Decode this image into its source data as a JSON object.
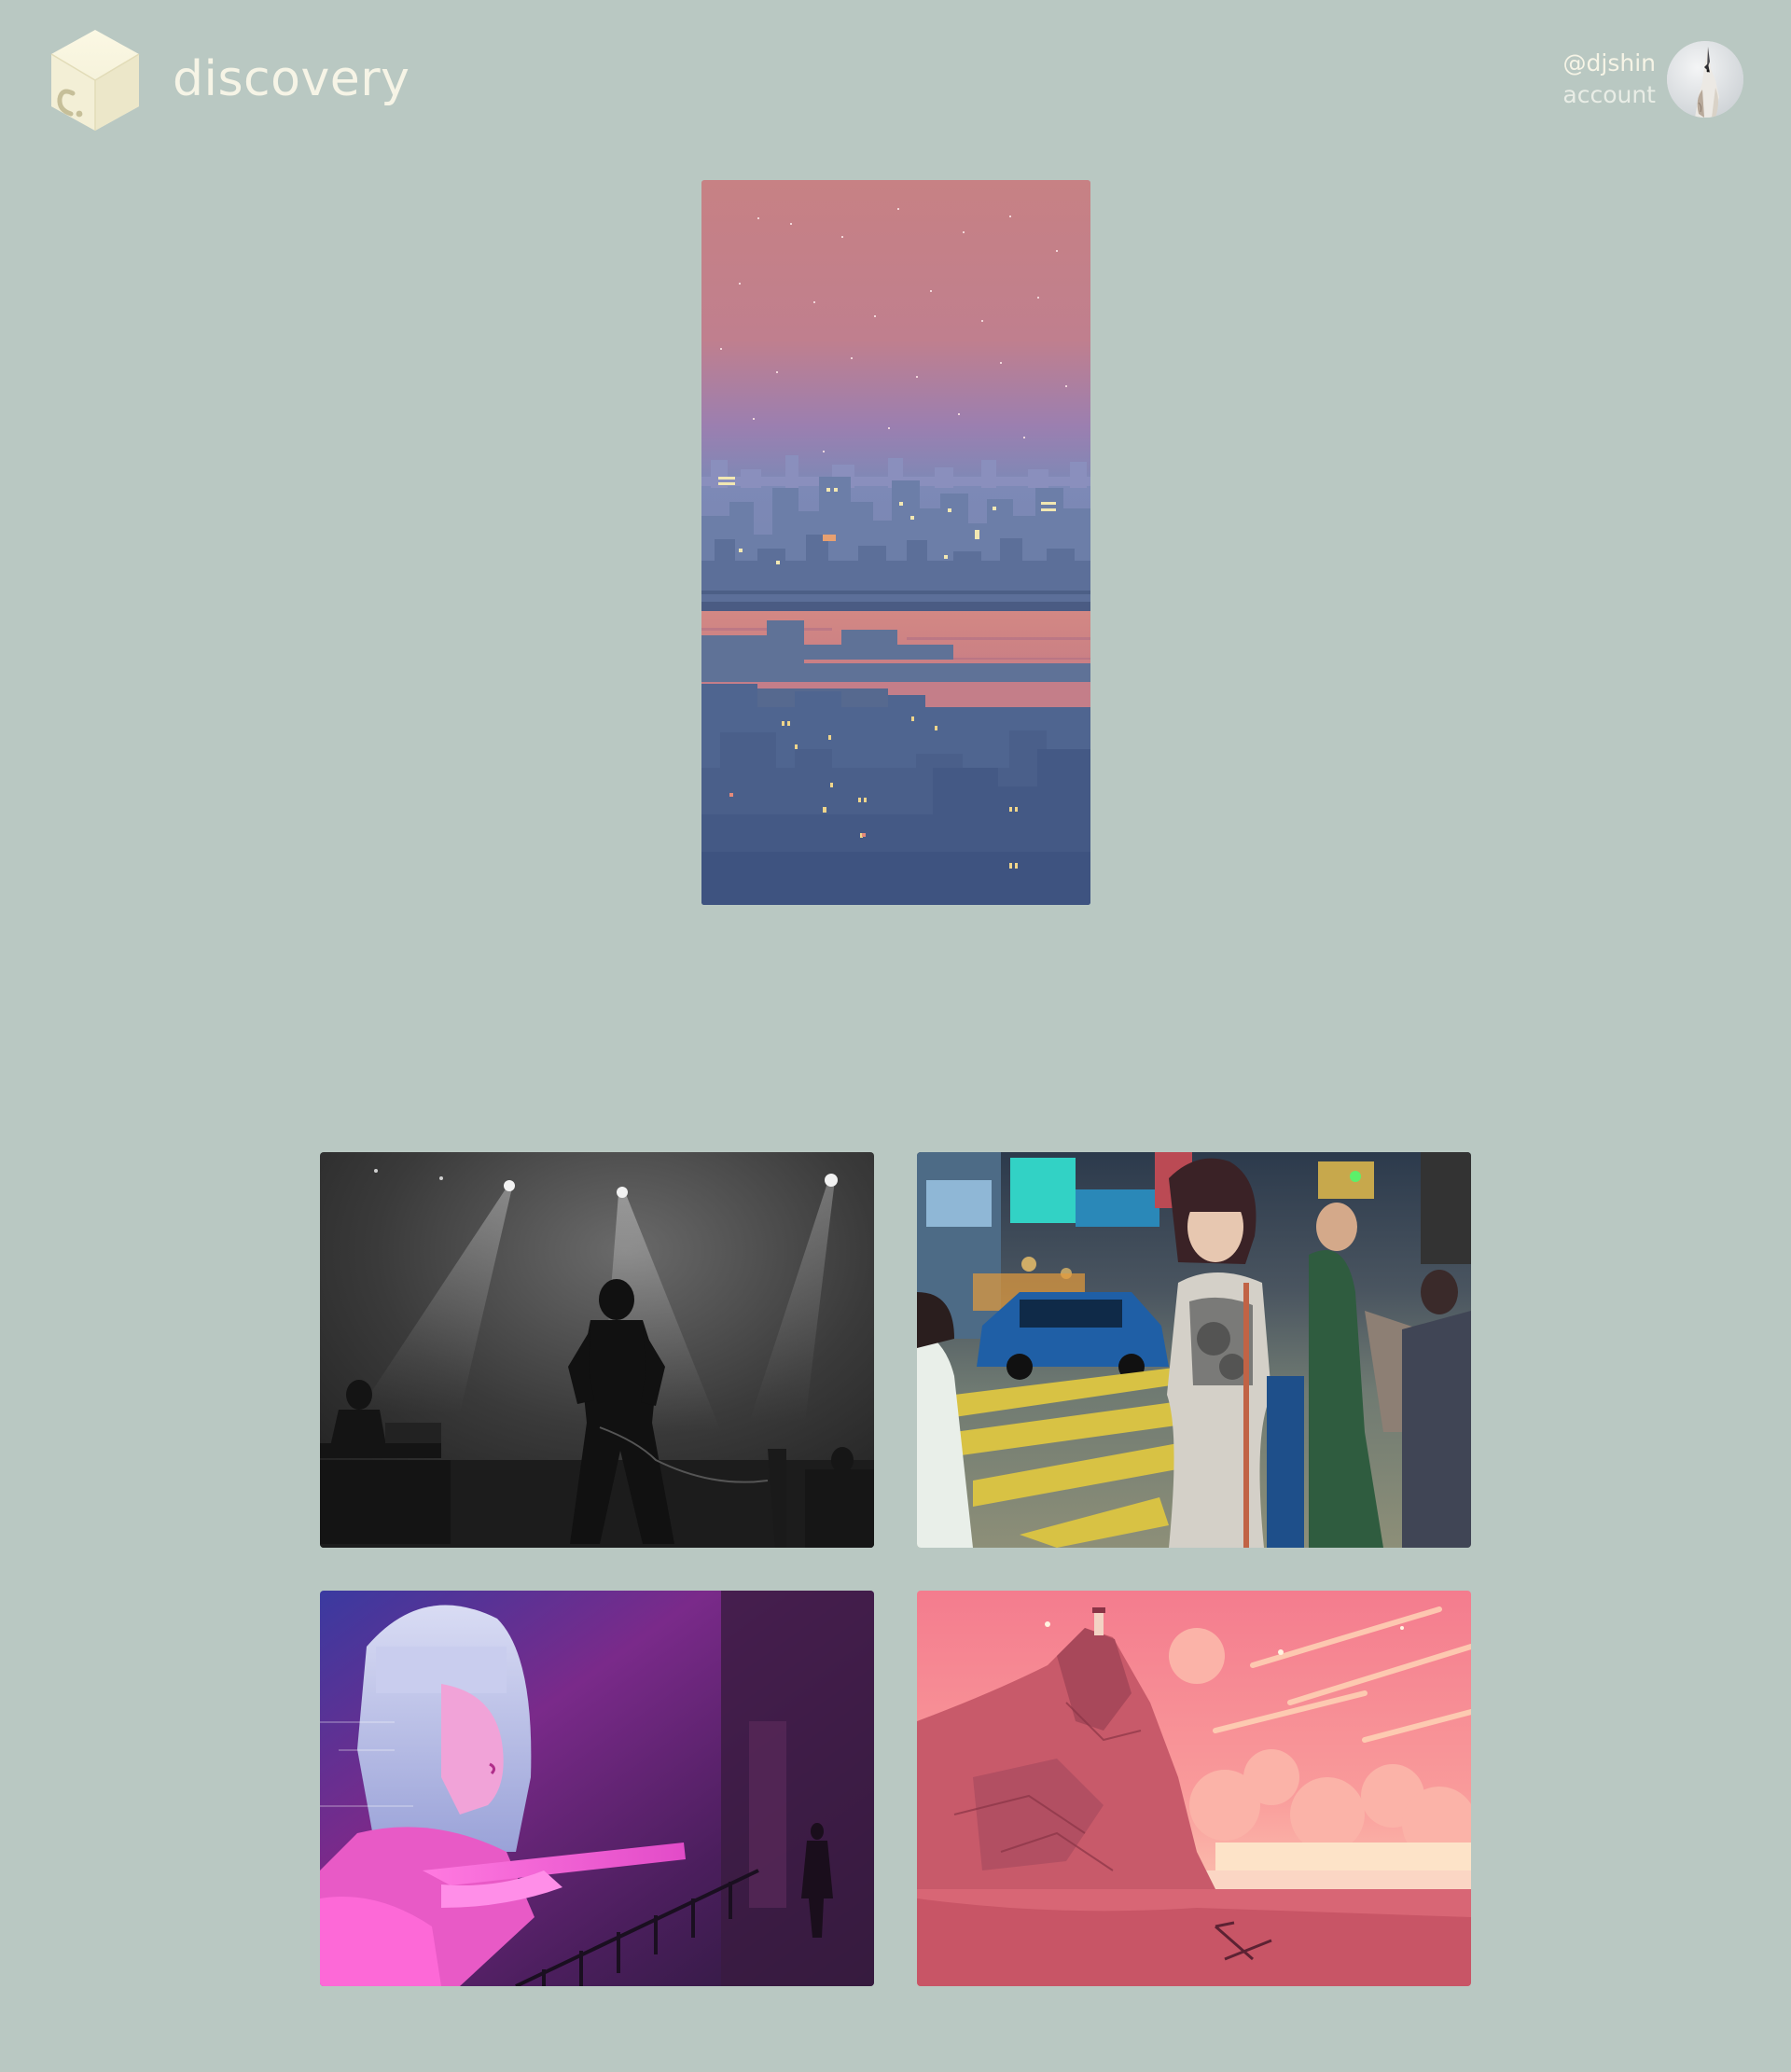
{
  "header": {
    "brand": "discovery",
    "logo_icon": "hexagon-cube-logo-icon",
    "account": {
      "handle": "@djshin",
      "label": "account",
      "avatar_icon": "bird-avatar-icon"
    }
  },
  "featured": {
    "image": "pixel-art-city-sunset-image"
  },
  "gallery": [
    {
      "image": "concert-black-white-photo"
    },
    {
      "image": "street-crossing-woman-photo"
    },
    {
      "image": "neon-hologram-woman-image"
    },
    {
      "image": "pink-cliff-lighthouse-illustration"
    }
  ],
  "colors": {
    "background": "#b9c8c2",
    "text_light": "#f6f4e6",
    "logo": "#f5f2d8"
  }
}
